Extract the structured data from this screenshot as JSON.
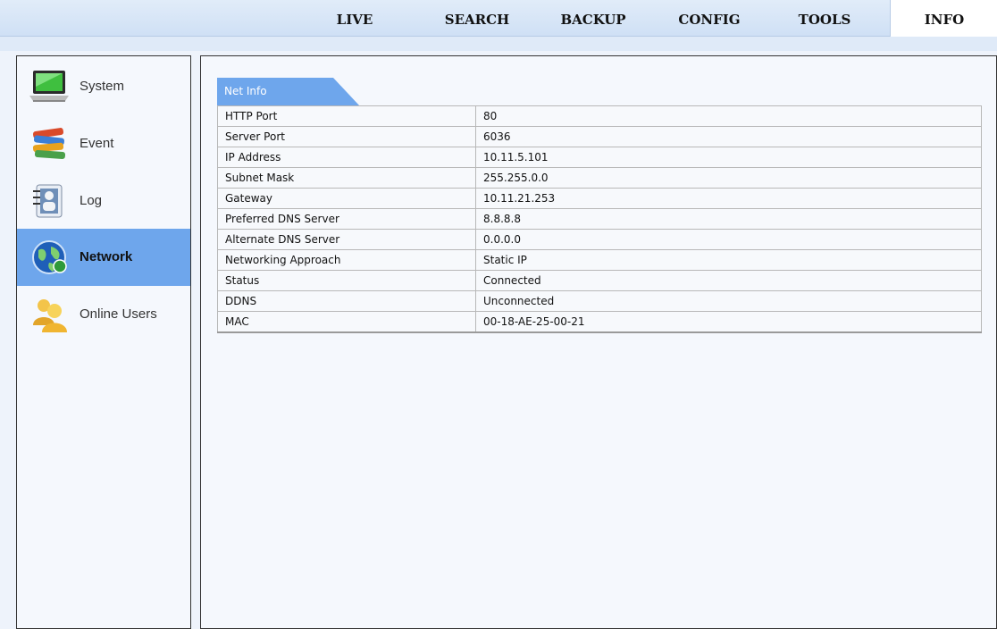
{
  "nav": {
    "items": [
      {
        "label": "LIVE",
        "active": false
      },
      {
        "label": "SEARCH",
        "active": false
      },
      {
        "label": "BACKUP",
        "active": false
      },
      {
        "label": "CONFIG",
        "active": false
      },
      {
        "label": "TOOLS",
        "active": false
      },
      {
        "label": "INFO",
        "active": true
      }
    ]
  },
  "sidebar": {
    "items": [
      {
        "label": "System",
        "icon": "laptop-icon",
        "active": false
      },
      {
        "label": "Event",
        "icon": "books-icon",
        "active": false
      },
      {
        "label": "Log",
        "icon": "address-book-icon",
        "active": false
      },
      {
        "label": "Network",
        "icon": "globe-icon",
        "active": true
      },
      {
        "label": "Online Users",
        "icon": "users-icon",
        "active": false
      }
    ]
  },
  "panel": {
    "tab_label": "Net Info",
    "rows": [
      {
        "key": "HTTP Port",
        "value": "80"
      },
      {
        "key": "Server Port",
        "value": "6036"
      },
      {
        "key": "IP Address",
        "value": "10.11.5.101"
      },
      {
        "key": "Subnet Mask",
        "value": "255.255.0.0"
      },
      {
        "key": "Gateway",
        "value": "10.11.21.253"
      },
      {
        "key": "Preferred DNS Server",
        "value": "8.8.8.8"
      },
      {
        "key": "Alternate DNS Server",
        "value": "0.0.0.0"
      },
      {
        "key": "Networking Approach",
        "value": "Static IP"
      },
      {
        "key": "Status",
        "value": "Connected"
      },
      {
        "key": "DDNS",
        "value": "Unconnected"
      },
      {
        "key": "MAC",
        "value": "00-18-AE-25-00-21"
      }
    ]
  },
  "colors": {
    "active_sidebar": "#6ea6ec",
    "tab": "#6ea6ec",
    "background": "#eef3fb"
  }
}
